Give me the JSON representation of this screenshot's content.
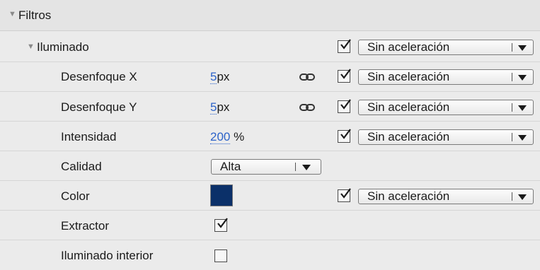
{
  "section": {
    "title": "Filtros"
  },
  "filter": {
    "name": "Iluminado",
    "enabled": true,
    "easing": "Sin aceleración"
  },
  "rows": {
    "blur_x": {
      "label": "Desenfoque X",
      "value": "5",
      "unit": "px",
      "enabled": true,
      "easing": "Sin aceleración"
    },
    "blur_y": {
      "label": "Desenfoque Y",
      "value": "5",
      "unit": "px",
      "enabled": true,
      "easing": "Sin aceleración"
    },
    "strength": {
      "label": "Intensidad",
      "value": "200",
      "unit": "%",
      "enabled": true,
      "easing": "Sin aceleración"
    },
    "quality": {
      "label": "Calidad",
      "value": "Alta"
    },
    "color": {
      "label": "Color",
      "swatch": "#0b3069",
      "enabled": true,
      "easing": "Sin aceleración"
    },
    "knockout": {
      "label": "Extractor",
      "checked": true
    },
    "inner": {
      "label": "Iluminado interior",
      "checked": false
    }
  }
}
